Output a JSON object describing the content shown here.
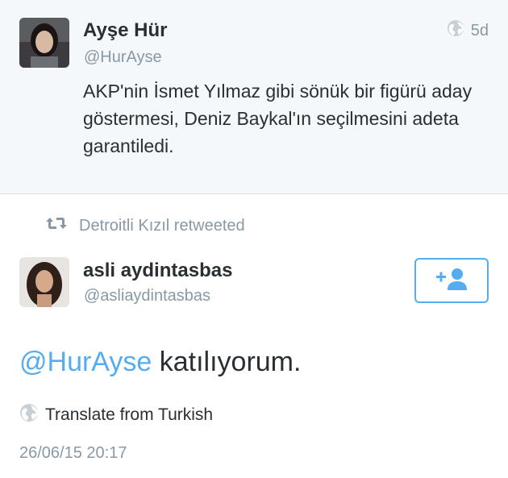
{
  "top_tweet": {
    "name": "Ayşe Hür",
    "handle": "@HurAyse",
    "age": "5d",
    "text": "AKP'nin İsmet Yılmaz gibi sönük bir figürü aday göstermesi, Deniz Baykal'ın seçilmesini adeta garantiledi."
  },
  "retweet": {
    "label": "Detroitli Kızıl retweeted"
  },
  "main_tweet": {
    "name": "asli aydintasbas",
    "handle": "@asliaydintasbas",
    "mention": "@HurAyse",
    "text": " katılıyorum.",
    "translate_label": "Translate from Turkish",
    "timestamp": "26/06/15 20:17"
  },
  "colors": {
    "accent": "#55acee",
    "muted": "#8899a6",
    "text": "#292f33",
    "top_bg": "#f5f8fa"
  },
  "icons": {
    "globe": "globe-icon",
    "retweet": "retweet-icon",
    "follow": "add-user-icon"
  }
}
